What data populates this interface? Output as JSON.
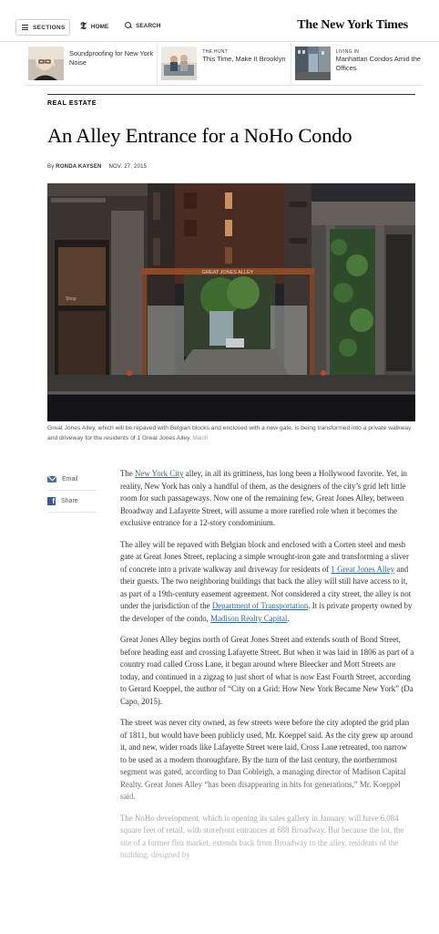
{
  "header": {
    "sections_label": "SECTIONS",
    "home_label": "HOME",
    "search_label": "SEARCH",
    "logo_text": "The New York Times"
  },
  "related": [
    {
      "kicker": "",
      "title": "Soundproofing for New York Noise",
      "icon": "woman-portrait-thumbnail"
    },
    {
      "kicker": "THE HUNT",
      "title": "This Time, Make It Brooklyn",
      "icon": "couple-on-sofa-thumbnail"
    },
    {
      "kicker": "LIVING IN",
      "title": "Manhattan Condos Amid the Offices",
      "icon": "street-scene-thumbnail"
    }
  ],
  "article": {
    "kicker": "REAL ESTATE",
    "headline": "An Alley Entrance for a NoHo Condo",
    "byline_prefix": "By",
    "author": "RONDA KAYSEN",
    "date": "NOV. 27, 2015",
    "photo_sign": "GREAT JONES ALLEY",
    "photo_storefront": "Shop",
    "caption": "Great Jones Alley, which will be repaved with Belgian blocks and enclosed with a new gate, is being transformed into a private walkway and driveway for the residents of 1 Great Jones Alley.",
    "caption_credit": "March"
  },
  "share": {
    "email_label": "Email",
    "share_label": "Share"
  },
  "paragraphs": {
    "p1_pre": "The ",
    "p1_link": "New York City",
    "p1_post": " alley, in all its grittiness, has long been a Hollywood favorite. Yet, in reality, New York has only a handful of them, as the designers of the city’s grid left little room for such passageways. Now one of the remaining few, Great Jones Alley, between Broadway and Lafayette Street, will assume a more rarefied role when it becomes the exclusive entrance for a 12-story condominium.",
    "p2_pre": "The alley will be repaved with Belgian block and enclosed with a Corten steel and mesh gate at Great Jones Street, replacing a simple wrought-iron gate and transforming a sliver of concrete into a private walkway and driveway for residents of ",
    "p2_link1": "1 Great Jones Alley",
    "p2_mid": " and their guests. The two neighboring buildings that back the alley will still have access to it, as part of a 19th-century easement agreement. Not considered a city street, the alley is not under the jurisdiction of the ",
    "p2_link2": "Department of Transportation",
    "p2_mid2": ". It is private property owned by the developer of the condo, ",
    "p2_link3": "Madison Realty Capital",
    "p2_post": ".",
    "p3": "Great Jones Alley begins north of Great Jones Street and extends south of Bond Street, before heading east and crossing Lafayette Street. But when it was laid in 1806 as part of a country road called Cross Lane, it began around where Bleecker and Mott Streets are today, and continued in a zigzag to just short of what is now East Fourth Street, according to Gerard Koeppel, the author of “City on a Grid: How New York Became New York” (Da Capo, 2015).",
    "p4": "The street was never city owned, as few streets were before the city adopted the grid plan of 1811, but would have been publicly used, Mr. Koeppel said. As the city grew up around it, and new, wider roads like Lafayette Street were laid, Cross Lane retreated, too narrow to be used as a modern thoroughfare. By the turn of the last century, the northernmost segment was gated, according to Dan Cobleigh, a managing director of Madison Capital Realty. Great Jones Alley “has been disappearing in bits for generations,” Mr. Koeppel said.",
    "p5": "The NoHo development, which is opening its sales gallery in January, will have 6,084 square feet of retail, with storefront entrances at 688 Broadway. But because the lot, the site of a former flea market, extends back from Broadway to the alley, residents of the building, designed by"
  },
  "colors": {
    "link": "#326891",
    "text": "#333333",
    "facebook": "#3b5998"
  }
}
